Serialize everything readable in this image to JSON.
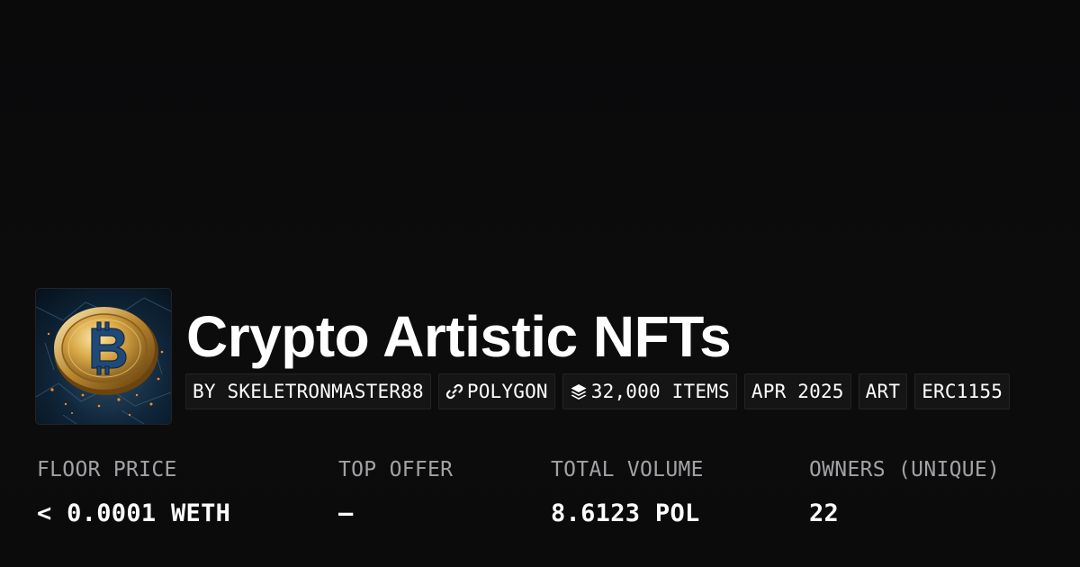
{
  "collection": {
    "title": "Crypto Artistic NFTs",
    "image_icon": "bitcoin-coin-artwork"
  },
  "tags": [
    {
      "label": "BY SKELETRONMASTER88"
    },
    {
      "label": "POLYGON",
      "icon": "link-icon"
    },
    {
      "label": "32,000 ITEMS",
      "icon": "stack-icon"
    },
    {
      "label": "APR 2025"
    },
    {
      "label": "ART"
    },
    {
      "label": "ERC1155"
    }
  ],
  "stats": [
    {
      "label": "FLOOR PRICE",
      "value": "< 0.0001 WETH"
    },
    {
      "label": "TOP OFFER",
      "value": "–"
    },
    {
      "label": "TOTAL VOLUME",
      "value": "8.6123 POL"
    },
    {
      "label": "OWNERS (UNIQUE)",
      "value": "22"
    }
  ],
  "colors": {
    "background": "#0b0b0c",
    "tag_background": "#151516",
    "label_gray": "#a2a2a6",
    "text": "#ffffff"
  }
}
